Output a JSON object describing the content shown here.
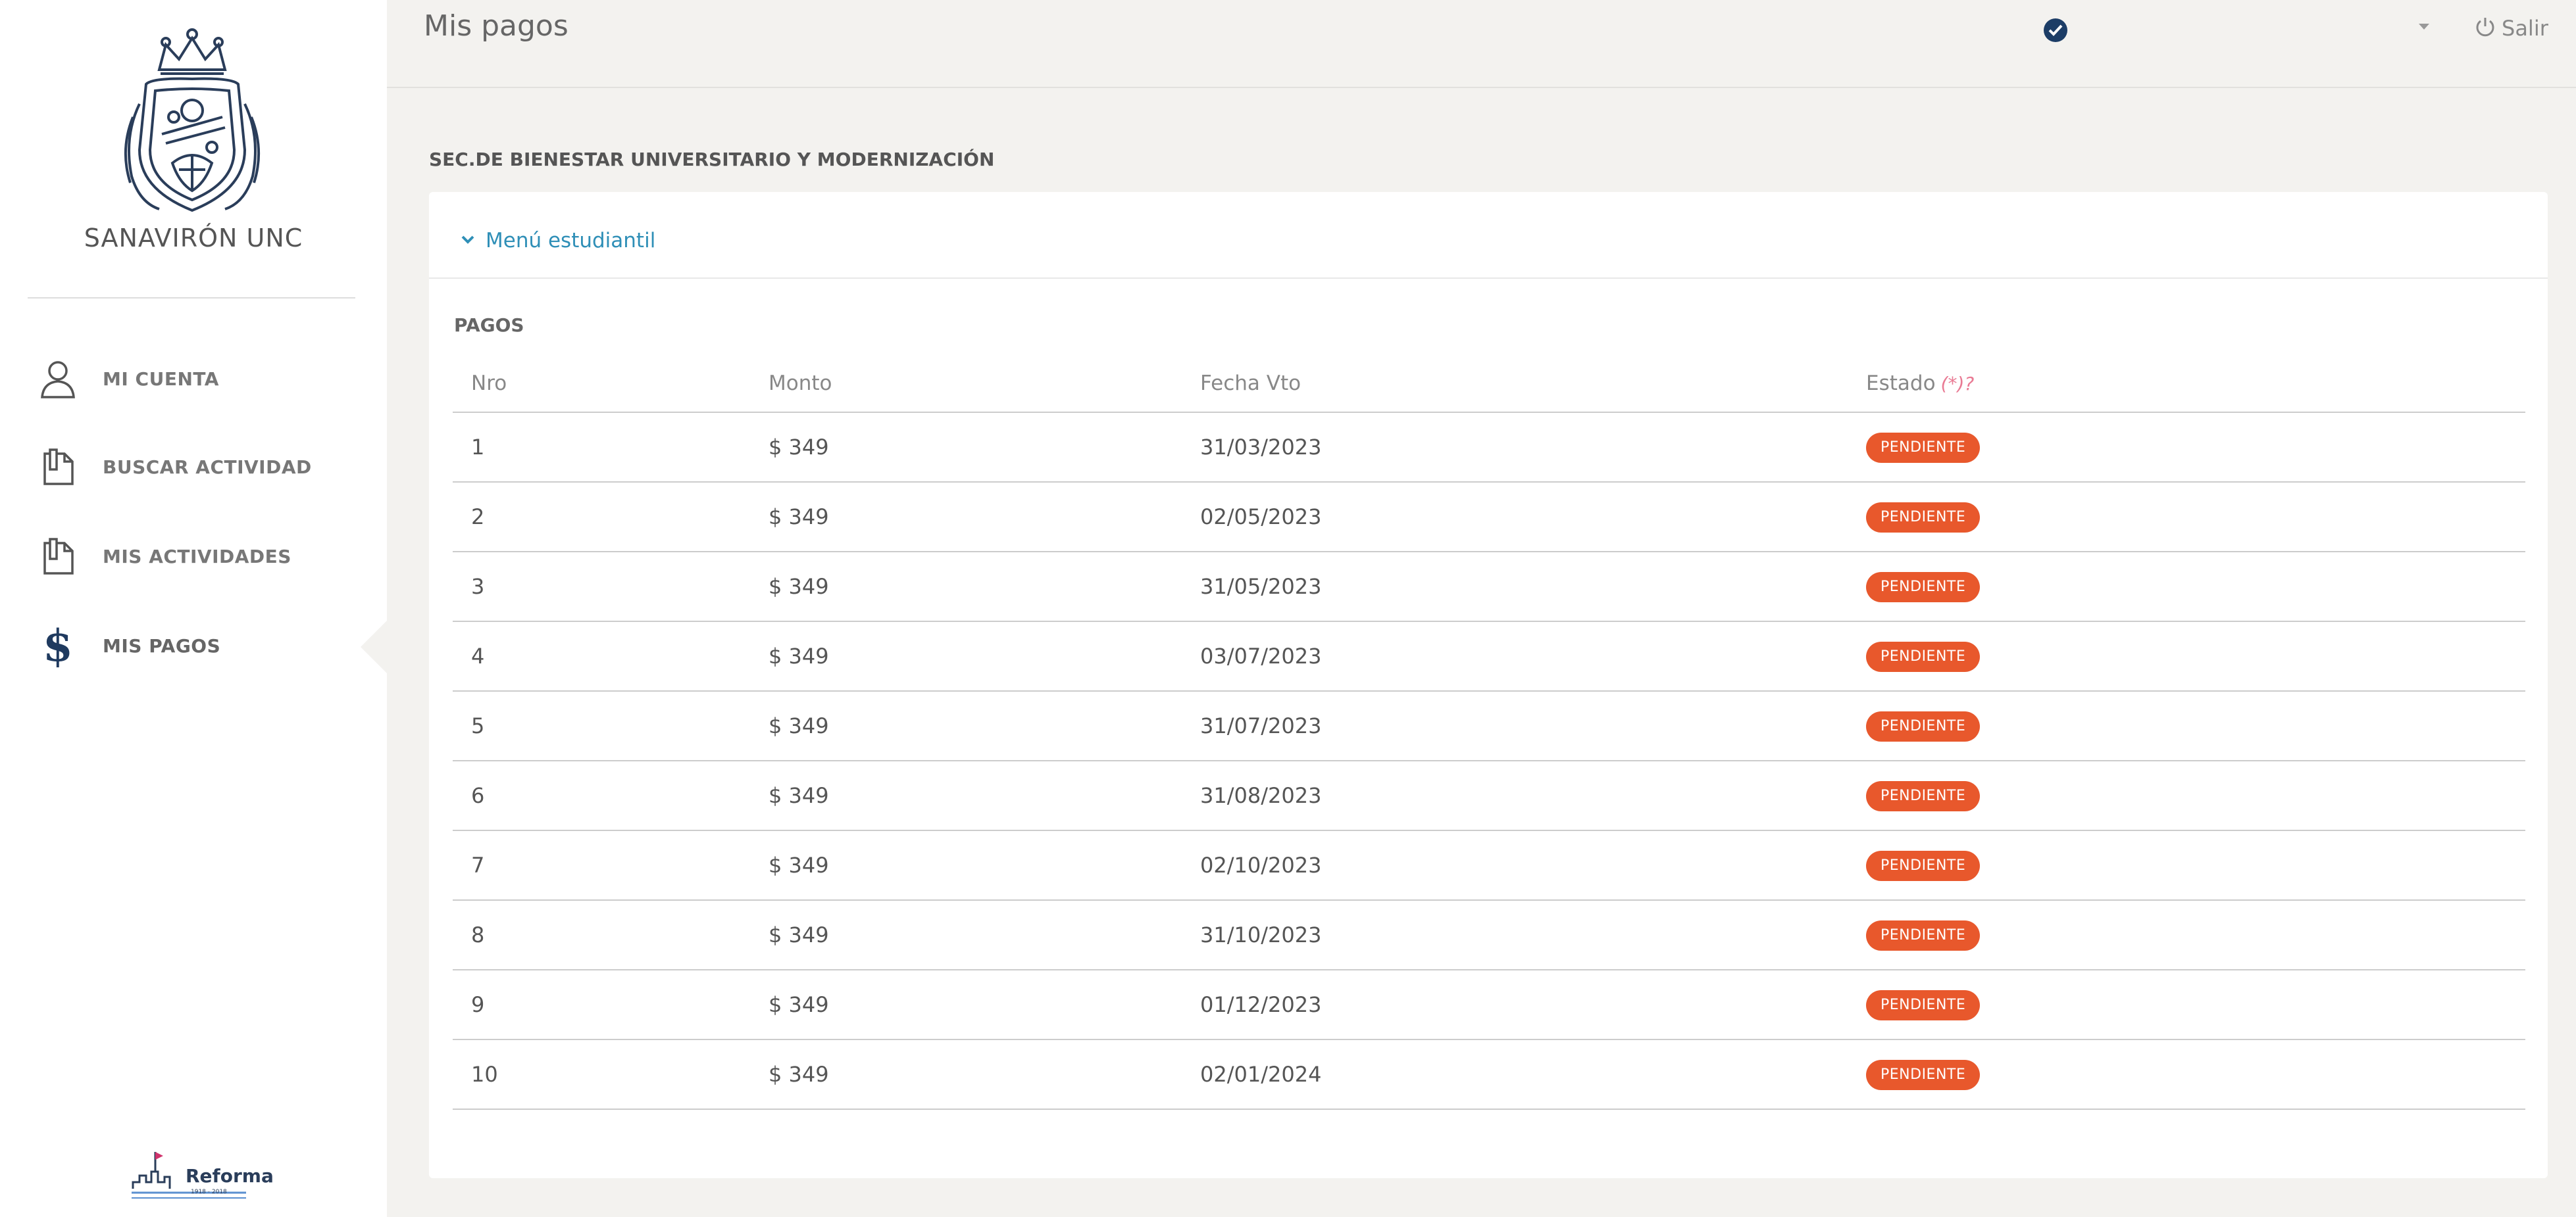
{
  "sidebar": {
    "brand": "SANAVIRÓN UNC",
    "items": [
      {
        "label": "MI CUENTA",
        "icon": "user-icon"
      },
      {
        "label": "BUSCAR ACTIVIDAD",
        "icon": "document-icon"
      },
      {
        "label": "MIS ACTIVIDADES",
        "icon": "document-icon"
      },
      {
        "label": "MIS PAGOS",
        "icon": "dollar-icon",
        "active": true
      }
    ],
    "footer_logo_text": "Reforma",
    "footer_logo_years": "1918 - 2018"
  },
  "header": {
    "title": "Mis pagos",
    "logout_label": "Salir"
  },
  "content": {
    "section_title": "SEC.DE BIENESTAR UNIVERSITARIO Y MODERNIZACIÓN",
    "menu_toggle_label": "Menú estudiantil",
    "table_title": "PAGOS",
    "columns": {
      "nro": "Nro",
      "monto": "Monto",
      "fecha": "Fecha Vto",
      "estado": "Estado",
      "estado_note": "(*)?"
    },
    "rows": [
      {
        "nro": "1",
        "monto": "$ 349",
        "fecha": "31/03/2023",
        "estado": "PENDIENTE"
      },
      {
        "nro": "2",
        "monto": "$ 349",
        "fecha": "02/05/2023",
        "estado": "PENDIENTE"
      },
      {
        "nro": "3",
        "monto": "$ 349",
        "fecha": "31/05/2023",
        "estado": "PENDIENTE"
      },
      {
        "nro": "4",
        "monto": "$ 349",
        "fecha": "03/07/2023",
        "estado": "PENDIENTE"
      },
      {
        "nro": "5",
        "monto": "$ 349",
        "fecha": "31/07/2023",
        "estado": "PENDIENTE"
      },
      {
        "nro": "6",
        "monto": "$ 349",
        "fecha": "31/08/2023",
        "estado": "PENDIENTE"
      },
      {
        "nro": "7",
        "monto": "$ 349",
        "fecha": "02/10/2023",
        "estado": "PENDIENTE"
      },
      {
        "nro": "8",
        "monto": "$ 349",
        "fecha": "31/10/2023",
        "estado": "PENDIENTE"
      },
      {
        "nro": "9",
        "monto": "$ 349",
        "fecha": "01/12/2023",
        "estado": "PENDIENTE"
      },
      {
        "nro": "10",
        "monto": "$ 349",
        "fecha": "02/01/2024",
        "estado": "PENDIENTE"
      }
    ]
  },
  "colors": {
    "accent_link": "#2f8fb7",
    "badge_pending": "#e8582c",
    "nav_icon_dark": "#1f3a5f",
    "check_badge": "#1c3d66"
  }
}
